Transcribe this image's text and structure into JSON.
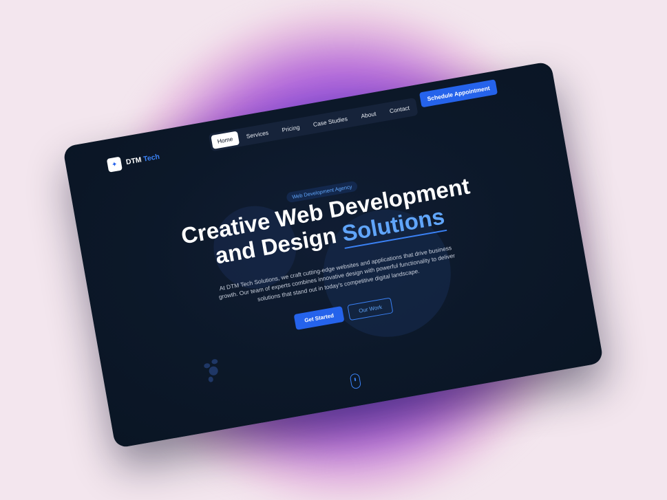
{
  "brand": {
    "name": "DTM",
    "accent": "Tech"
  },
  "nav": {
    "items": [
      "Home",
      "Services",
      "Pricing",
      "Case Studies",
      "About",
      "Contact"
    ],
    "active": "Home"
  },
  "header_cta": "Schedule Appointment",
  "hero": {
    "badge": "Web Development Agency",
    "title_line1": "Creative Web Development",
    "title_line2_prefix": "and Design",
    "title_accent": "Solutions",
    "description": "At DTM Tech Solutions, we craft cutting-edge websites and applications that drive business growth. Our team of experts combines innovative design with powerful functionality to deliver solutions that stand out in today's competitive digital landscape.",
    "primary_button": "Get Started",
    "secondary_button": "Our Work"
  },
  "colors": {
    "background": "#0c1829",
    "accent": "#3b82f6",
    "primary_button": "#2563eb",
    "text": "#ffffff"
  },
  "icons": [
    "logo-icon",
    "scroll-mouse-icon",
    "dots-decoration-icon"
  ]
}
